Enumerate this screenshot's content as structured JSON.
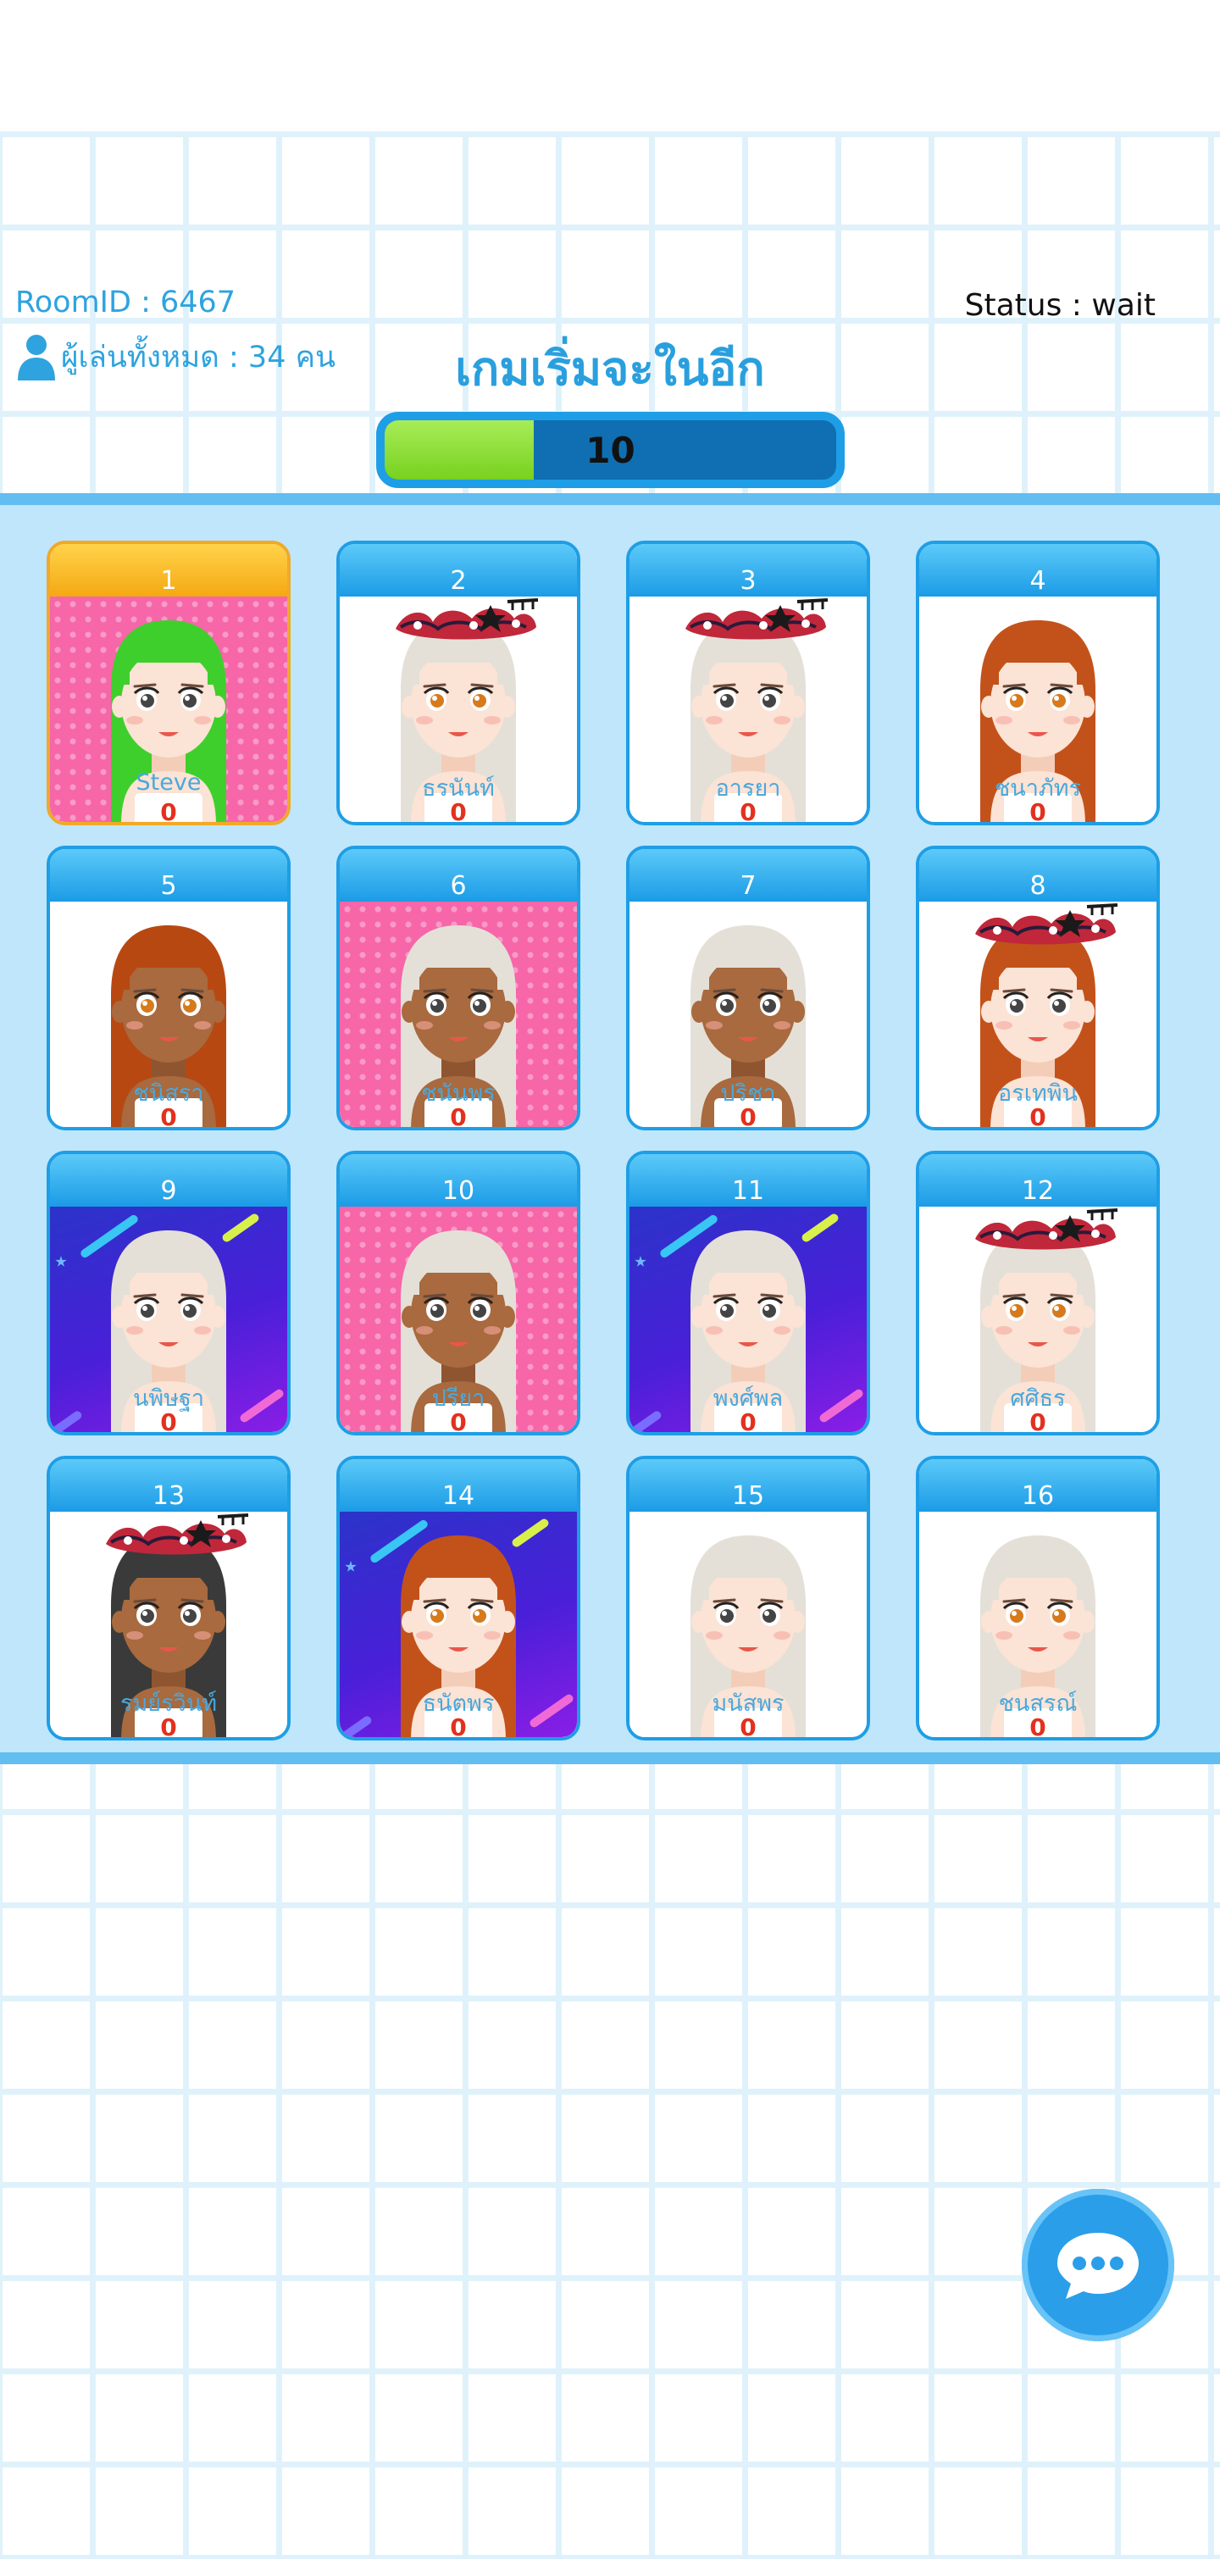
{
  "header": {
    "room_id": "RoomID : 6467",
    "status": "Status : wait",
    "players_count": "ผู้เล่นทั้งหมด : 34 คน",
    "countdown_title": "เกมเริ่มจะในอีก",
    "countdown_value": "10",
    "countdown_fraction": 0.33
  },
  "colors": {
    "accent": "#2a9fde",
    "progress_fill": "#78d11f",
    "current_card": "#f5a813",
    "score": "#e4301e"
  },
  "board": {
    "cards": [
      {
        "number": "1",
        "name": "Steve",
        "score": "0",
        "background": "pink",
        "hair": "#3fcf2d",
        "skin": "#fbe3d5",
        "eyes": "#444444",
        "crown": false,
        "current": true
      },
      {
        "number": "2",
        "name": "ธรนันท์",
        "score": "0",
        "background": "white",
        "hair": "#e4e0d8",
        "skin": "#fbe3d5",
        "eyes": "#d67a1c",
        "crown": true,
        "current": false
      },
      {
        "number": "3",
        "name": "อารยา",
        "score": "0",
        "background": "white",
        "hair": "#e4e0d8",
        "skin": "#fbe3d5",
        "eyes": "#444444",
        "crown": true,
        "current": false
      },
      {
        "number": "4",
        "name": "ชนาภัทร",
        "score": "0",
        "background": "white",
        "hair": "#c3521a",
        "skin": "#fbe3d5",
        "eyes": "#d67a1c",
        "crown": false,
        "current": false
      },
      {
        "number": "5",
        "name": "ชนิสรา",
        "score": "0",
        "background": "white",
        "hair": "#b84812",
        "skin": "#a86a3e",
        "eyes": "#d67a1c",
        "crown": false,
        "current": false
      },
      {
        "number": "6",
        "name": "ชนันพร",
        "score": "0",
        "background": "pink",
        "hair": "#e4e0d8",
        "skin": "#a86a3e",
        "eyes": "#444444",
        "crown": false,
        "current": false
      },
      {
        "number": "7",
        "name": "ปริชา",
        "score": "0",
        "background": "white",
        "hair": "#e4e0d8",
        "skin": "#a86a3e",
        "eyes": "#444444",
        "crown": false,
        "current": false
      },
      {
        "number": "8",
        "name": "อรเทพิน",
        "score": "0",
        "background": "white",
        "hair": "#c3521a",
        "skin": "#fbe3d5",
        "eyes": "#444444",
        "crown": true,
        "current": false
      },
      {
        "number": "9",
        "name": "นพิษฐา",
        "score": "0",
        "background": "space",
        "hair": "#e4e0d8",
        "skin": "#fbe3d5",
        "eyes": "#444444",
        "crown": false,
        "current": false
      },
      {
        "number": "10",
        "name": "ปรียา",
        "score": "0",
        "background": "pink",
        "hair": "#e4e0d8",
        "skin": "#a86a3e",
        "eyes": "#444444",
        "crown": false,
        "current": false
      },
      {
        "number": "11",
        "name": "พงศ์พล",
        "score": "0",
        "background": "space",
        "hair": "#e4e0d8",
        "skin": "#fbe3d5",
        "eyes": "#444444",
        "crown": false,
        "current": false
      },
      {
        "number": "12",
        "name": "ศศิธร",
        "score": "0",
        "background": "white",
        "hair": "#e4e0d8",
        "skin": "#fbe3d5",
        "eyes": "#d67a1c",
        "crown": true,
        "current": false
      },
      {
        "number": "13",
        "name": "รมย์รวินท์",
        "score": "0",
        "background": "white",
        "hair": "#3a3a3a",
        "skin": "#a86a3e",
        "eyes": "#444444",
        "crown": true,
        "current": false
      },
      {
        "number": "14",
        "name": "ธนัตพร",
        "score": "0",
        "background": "space",
        "hair": "#c3521a",
        "skin": "#fbe3d5",
        "eyes": "#d67a1c",
        "crown": false,
        "current": false
      },
      {
        "number": "15",
        "name": "มนัสพร",
        "score": "0",
        "background": "white",
        "hair": "#e4e0d8",
        "skin": "#fbe3d5",
        "eyes": "#444444",
        "crown": false,
        "current": false
      },
      {
        "number": "16",
        "name": "ชนสรณ์",
        "score": "0",
        "background": "white",
        "hair": "#e4e0d8",
        "skin": "#fbe3d5",
        "eyes": "#d67a1c",
        "crown": false,
        "current": false
      }
    ]
  },
  "chat": {
    "icon": "chat-bubble-icon"
  }
}
